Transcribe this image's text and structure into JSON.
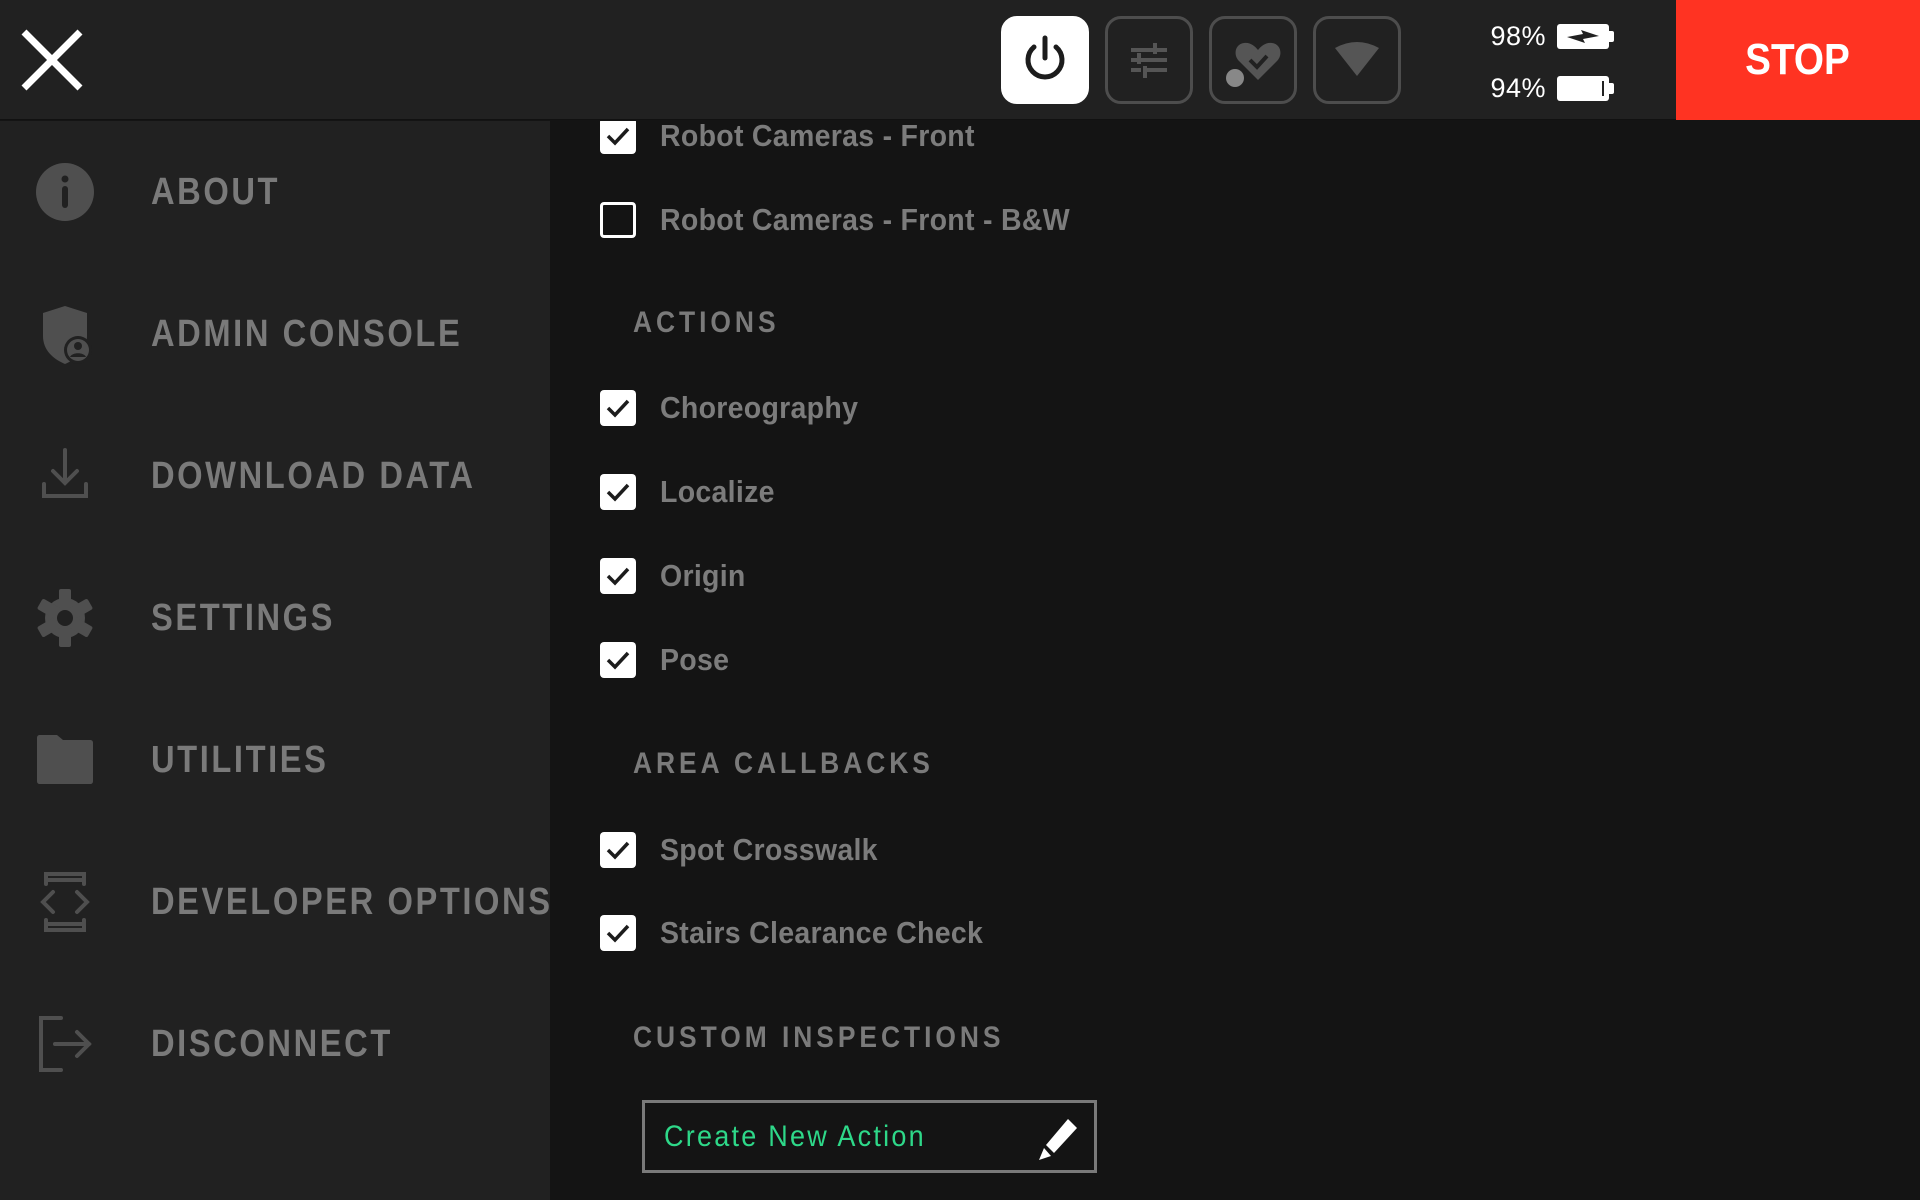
{
  "header": {
    "close_icon": "close-icon",
    "status_buttons": [
      {
        "name": "power",
        "icon": "power-icon",
        "active": true
      },
      {
        "name": "controls",
        "icon": "sliders-icon",
        "active": false
      },
      {
        "name": "health",
        "icon": "heart-check-icon",
        "active": false
      },
      {
        "name": "wifi",
        "icon": "wifi-icon",
        "active": false
      }
    ],
    "batteries": [
      {
        "percent_label": "98%",
        "percent": 98,
        "charging": true
      },
      {
        "percent_label": "94%",
        "percent": 94,
        "charging": false
      }
    ],
    "stop_label": "STOP",
    "stop_color": "#ff3322"
  },
  "sidebar": {
    "items": [
      {
        "label": "ABOUT",
        "icon": "info-icon"
      },
      {
        "label": "ADMIN CONSOLE",
        "icon": "admin-shield-icon"
      },
      {
        "label": "DOWNLOAD DATA",
        "icon": "download-icon"
      },
      {
        "label": "SETTINGS",
        "icon": "gear-icon"
      },
      {
        "label": "UTILITIES",
        "icon": "folder-icon"
      },
      {
        "label": "DEVELOPER OPTIONS",
        "icon": "developer-code-icon"
      },
      {
        "label": "DISCONNECT",
        "icon": "logout-icon"
      }
    ]
  },
  "main": {
    "top_items": [
      {
        "label": "Robot Cameras - Front",
        "checked": true
      },
      {
        "label": "Robot Cameras - Front - B&W",
        "checked": false
      }
    ],
    "sections": [
      {
        "title": "ACTIONS",
        "items": [
          {
            "label": "Choreography",
            "checked": true
          },
          {
            "label": "Localize",
            "checked": true
          },
          {
            "label": "Origin",
            "checked": true
          },
          {
            "label": "Pose",
            "checked": true
          }
        ]
      },
      {
        "title": "AREA CALLBACKS",
        "items": [
          {
            "label": "Spot Crosswalk",
            "checked": true
          },
          {
            "label": "Stairs Clearance Check",
            "checked": true
          }
        ]
      },
      {
        "title": "CUSTOM INSPECTIONS",
        "items": []
      }
    ],
    "create_action_label": "Create New Action",
    "accent_color": "#2ed889"
  }
}
